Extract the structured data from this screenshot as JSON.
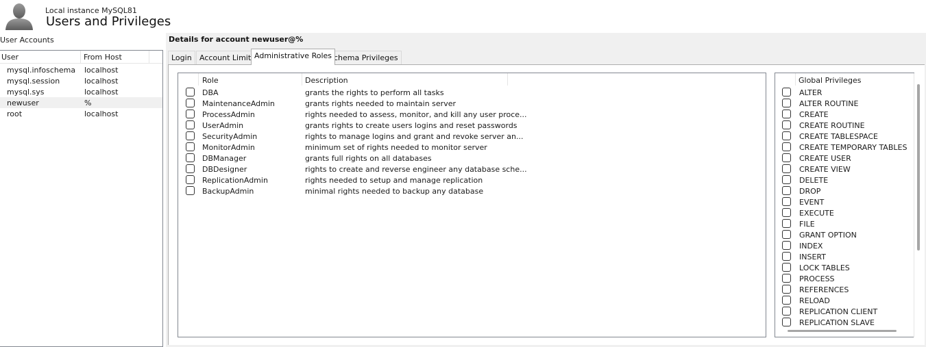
{
  "header": {
    "instance": "Local instance MySQL81",
    "title": "Users and Privileges"
  },
  "user_accounts": {
    "label": "User Accounts",
    "columns": [
      "User",
      "From Host"
    ],
    "rows": [
      {
        "user": "mysql.infoschema",
        "host": "localhost"
      },
      {
        "user": "mysql.session",
        "host": "localhost"
      },
      {
        "user": "mysql.sys",
        "host": "localhost"
      },
      {
        "user": "newuser",
        "host": "%"
      },
      {
        "user": "root",
        "host": "localhost"
      }
    ],
    "selected_index": 3
  },
  "details": {
    "title": "Details for account newuser@%",
    "tabs": [
      "Login",
      "Account Limits",
      "Administrative Roles",
      "Schema Privileges"
    ],
    "active_tab": "Administrative Roles"
  },
  "roles": {
    "columns": [
      "Role",
      "Description"
    ],
    "rows": [
      {
        "name": "DBA",
        "desc": "grants the rights to perform all tasks",
        "checked": false
      },
      {
        "name": "MaintenanceAdmin",
        "desc": "grants rights needed to maintain server",
        "checked": false
      },
      {
        "name": "ProcessAdmin",
        "desc": "rights needed to assess, monitor, and kill any user proce...",
        "checked": false
      },
      {
        "name": "UserAdmin",
        "desc": "grants rights to create users logins and reset passwords",
        "checked": false
      },
      {
        "name": "SecurityAdmin",
        "desc": "rights to manage logins and grant and revoke server an...",
        "checked": false
      },
      {
        "name": "MonitorAdmin",
        "desc": "minimum set of rights needed to monitor server",
        "checked": false
      },
      {
        "name": "DBManager",
        "desc": "grants full rights on all databases",
        "checked": false
      },
      {
        "name": "DBDesigner",
        "desc": "rights to create and reverse engineer any database sche...",
        "checked": false
      },
      {
        "name": "ReplicationAdmin",
        "desc": "rights needed to setup and manage replication",
        "checked": false
      },
      {
        "name": "BackupAdmin",
        "desc": "minimal rights needed to backup any database",
        "checked": false
      }
    ]
  },
  "global_privileges": {
    "column": "Global Privileges",
    "items": [
      "ALTER",
      "ALTER ROUTINE",
      "CREATE",
      "CREATE ROUTINE",
      "CREATE TABLESPACE",
      "CREATE TEMPORARY TABLES",
      "CREATE USER",
      "CREATE VIEW",
      "DELETE",
      "DROP",
      "EVENT",
      "EXECUTE",
      "FILE",
      "GRANT OPTION",
      "INDEX",
      "INSERT",
      "LOCK TABLES",
      "PROCESS",
      "REFERENCES",
      "RELOAD",
      "REPLICATION CLIENT",
      "REPLICATION SLAVE"
    ]
  },
  "icons": {
    "avatar": "user-avatar-icon",
    "checkbox": "checkbox-unchecked-icon"
  },
  "colors": {
    "selection": "#f0f0f0",
    "panel_bg": "#f0f0f0",
    "border": "#828790"
  }
}
